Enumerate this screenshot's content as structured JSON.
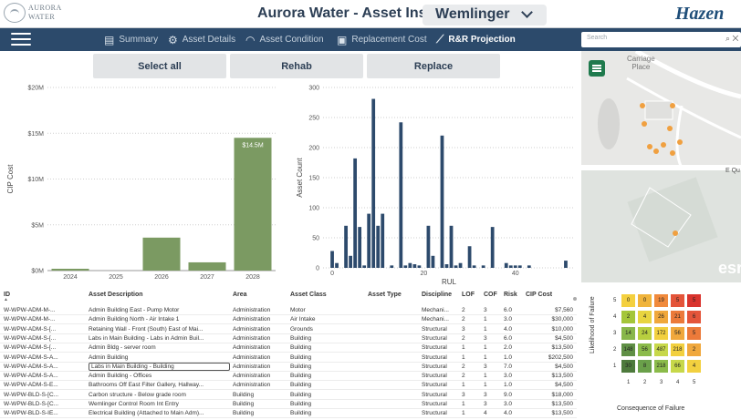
{
  "header": {
    "logo_line1": "AURORA",
    "logo_line2": "WATER",
    "title": "Aurora Water - Asset Insight:",
    "facility_selected": "Wemlinger",
    "brand": "Hazen"
  },
  "nav": {
    "items": [
      {
        "label": "Summary",
        "icon": "report-icon"
      },
      {
        "label": "Asset Details",
        "icon": "gear-tools-icon"
      },
      {
        "label": "Asset Condition",
        "icon": "gauge-icon"
      },
      {
        "label": "Replacement Cost",
        "icon": "money-icon"
      },
      {
        "label": "R&R Projection",
        "icon": "trend-chart-icon",
        "active": true
      }
    ],
    "search_placeholder": "Search"
  },
  "filters": {
    "select_all": "Select all",
    "rehab": "Rehab",
    "replace": "Replace"
  },
  "chart_data": [
    {
      "type": "bar",
      "ylabel": "CIP Cost",
      "categories": [
        "2024",
        "2025",
        "2026",
        "2027",
        "2028"
      ],
      "values": [
        0.2,
        0,
        3.6,
        0.9,
        14.5
      ],
      "unit": "$M",
      "yticks": [
        "$0M",
        "$5M",
        "$10M",
        "$15M",
        "$20M"
      ],
      "ylim": [
        0,
        20
      ],
      "annotations": [
        "$14.5M"
      ],
      "color": "#7b9a62",
      "grid": true
    },
    {
      "type": "bar",
      "ylabel": "Asset Count",
      "xlabel": "RUL",
      "xlim": [
        -2,
        53
      ],
      "ylim": [
        0,
        300
      ],
      "xticks": [
        "0",
        "20",
        "40"
      ],
      "yticks": [
        "0",
        "50",
        "100",
        "150",
        "200",
        "250",
        "300"
      ],
      "x": [
        0,
        1,
        3,
        4,
        5,
        6,
        7,
        8,
        9,
        10,
        11,
        13,
        15,
        16,
        17,
        18,
        19,
        21,
        22,
        24,
        25,
        26,
        27,
        28,
        30,
        31,
        33,
        35,
        38,
        39,
        40,
        41,
        43,
        51
      ],
      "values": [
        28,
        8,
        70,
        20,
        182,
        68,
        4,
        90,
        281,
        70,
        90,
        4,
        242,
        4,
        8,
        6,
        4,
        70,
        20,
        220,
        6,
        70,
        4,
        8,
        36,
        4,
        4,
        68,
        8,
        4,
        4,
        4,
        4,
        12
      ],
      "color": "#2d4a6c",
      "grid": true
    }
  ],
  "map": {
    "label": "Carriage\nPlace",
    "street": "E Qu",
    "attribution": "esri"
  },
  "table": {
    "columns": [
      "ID",
      "Asset Description",
      "Area",
      "Asset Class",
      "Asset Type",
      "Discipline",
      "LOF",
      "COF",
      "Risk",
      "CIP Cost"
    ],
    "rows": [
      [
        "W-WPW-ADM-M-...",
        "Admin Building East - Pump Motor",
        "Administration",
        "Motor",
        "",
        "Mechani...",
        "2",
        "3",
        "6.0",
        "$7,560"
      ],
      [
        "W-WPW-ADM-M-...",
        "Admin Building North - Air Intake 1",
        "Administration",
        "Air Intake",
        "",
        "Mechani...",
        "2",
        "1",
        "3.0",
        "$30,000"
      ],
      [
        "W-WPW-ADM-S-[...",
        "Retaining Wall - Front (South) East of Mai...",
        "Administration",
        "Grounds",
        "",
        "Structural",
        "3",
        "1",
        "4.0",
        "$10,000"
      ],
      [
        "W-WPW-ADM-S-[...",
        "Labs in Main Building - Labs in Admin Buil...",
        "Administration",
        "Building",
        "",
        "Structural",
        "2",
        "3",
        "6.0",
        "$4,500"
      ],
      [
        "W-WPW-ADM-S-[...",
        "Admin Bldg - server room",
        "Administration",
        "Building",
        "",
        "Structural",
        "1",
        "1",
        "2.0",
        "$13,500"
      ],
      [
        "W-WPW-ADM-S-A...",
        "Admin Building",
        "Administration",
        "Building",
        "",
        "Structural",
        "1",
        "1",
        "1.0",
        "$202,500"
      ],
      [
        "W-WPW-ADM-S-A...",
        "Labs in Main Building - Building",
        "Administration",
        "Building",
        "",
        "Structural",
        "2",
        "3",
        "7.0",
        "$4,500"
      ],
      [
        "W-WPW-ADM-S-A...",
        "Admin Building - Offices",
        "Administration",
        "Building",
        "",
        "Structural",
        "2",
        "1",
        "3.0",
        "$13,500"
      ],
      [
        "W-WPW-ADM-S-E...",
        "Bathrooms Off East Filter Gallery, Hallway...",
        "Administration",
        "Building",
        "",
        "Structural",
        "1",
        "1",
        "1.0",
        "$4,500"
      ],
      [
        "W-WPW-BLD-S-[C...",
        "Carbon structure - Below grade room",
        "Building",
        "Building",
        "",
        "Structural",
        "3",
        "3",
        "9.0",
        "$18,000"
      ],
      [
        "W-WPW-BLD-S-[C...",
        "Wemlinger Control Room Int Entry",
        "Building",
        "Building",
        "",
        "Structural",
        "1",
        "3",
        "3.0",
        "$13,500"
      ],
      [
        "W-WPW-BLD-S-IE...",
        "Electrical Building (Attached to Main Adm)...",
        "Building",
        "Building",
        "",
        "Structural",
        "1",
        "4",
        "4.0",
        "$13,500"
      ]
    ]
  },
  "risk_matrix": {
    "ylabel": "Likelihood of Failure",
    "xlabel": "Consequence of Failure",
    "xticks": [
      "1",
      "2",
      "3",
      "4",
      "5"
    ],
    "yticks": [
      "5",
      "4",
      "3",
      "2",
      "1"
    ],
    "cells": [
      [
        {
          "v": "0",
          "c": "#f4d03f"
        },
        {
          "v": "0",
          "c": "#f0b43c"
        },
        {
          "v": "19",
          "c": "#f08a3c"
        },
        {
          "v": "5",
          "c": "#e4553a"
        },
        {
          "v": "5",
          "c": "#d9342e"
        }
      ],
      [
        {
          "v": "2",
          "c": "#a4c639"
        },
        {
          "v": "4",
          "c": "#e8d43f"
        },
        {
          "v": "26",
          "c": "#f0a83c"
        },
        {
          "v": "21",
          "c": "#ec7a3a"
        },
        {
          "v": "6",
          "c": "#e4553a"
        }
      ],
      [
        {
          "v": "14",
          "c": "#88b74a"
        },
        {
          "v": "24",
          "c": "#b8cf3f"
        },
        {
          "v": "172",
          "c": "#f2d03f"
        },
        {
          "v": "56",
          "c": "#f0a83c"
        },
        {
          "v": "5",
          "c": "#ec7a3a"
        }
      ],
      [
        {
          "v": "148",
          "c": "#5f8f45"
        },
        {
          "v": "56",
          "c": "#8bbb4a"
        },
        {
          "v": "487",
          "c": "#c7d84a"
        },
        {
          "v": "218",
          "c": "#f2d03f"
        },
        {
          "v": "2",
          "c": "#f0a83c"
        }
      ],
      [
        {
          "v": "30",
          "c": "#4d7a3c"
        },
        {
          "v": "8",
          "c": "#6aa04a"
        },
        {
          "v": "218",
          "c": "#8bbb4a"
        },
        {
          "v": "66",
          "c": "#c7d84a"
        },
        {
          "v": "4",
          "c": "#f2d03f"
        }
      ]
    ]
  }
}
